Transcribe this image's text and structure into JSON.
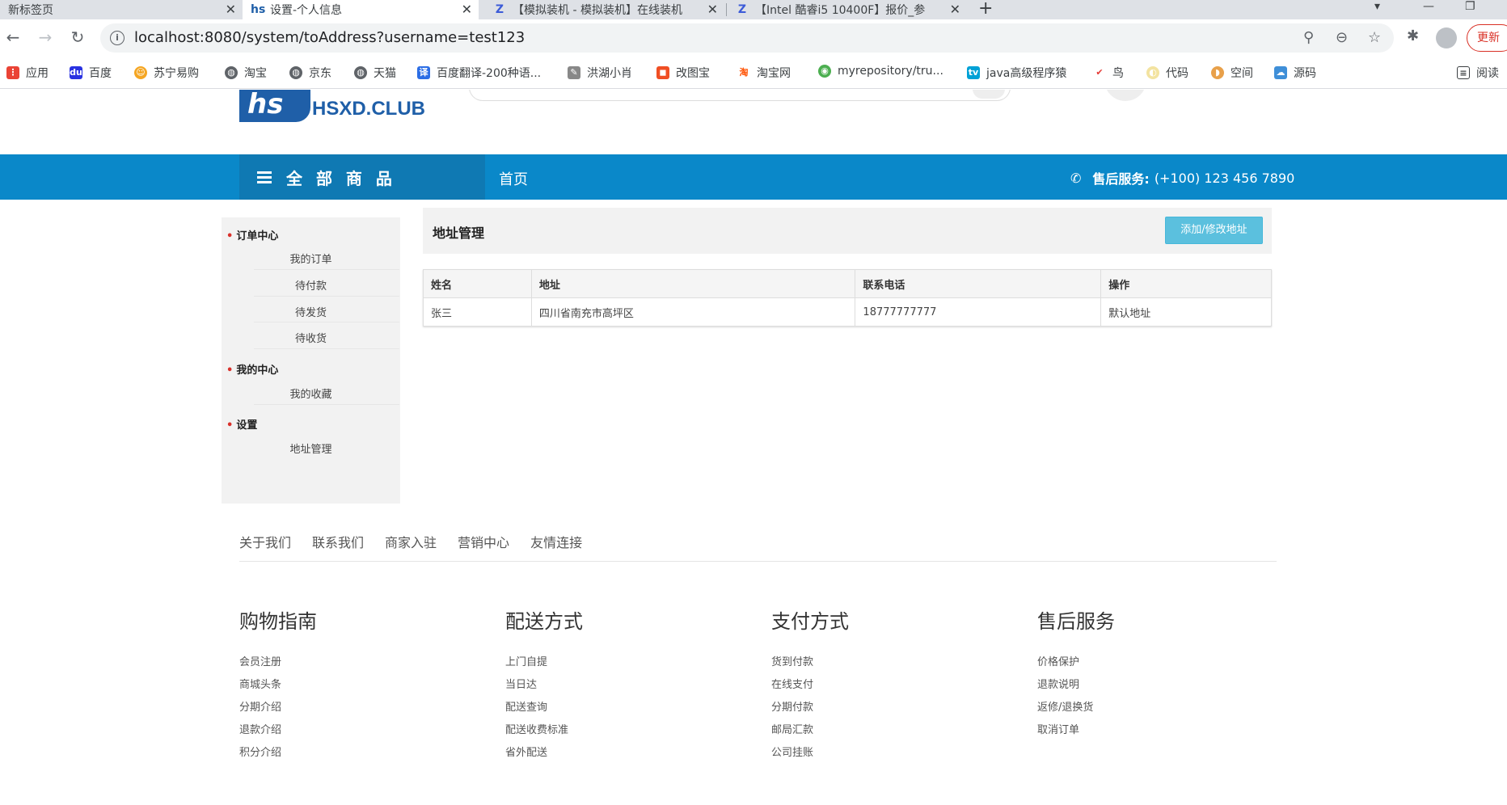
{
  "browser": {
    "tabs": [
      {
        "title": "新标签页"
      },
      {
        "title": "设置-个人信息"
      },
      {
        "title": "【模拟装机 - 模拟装机】在线装机"
      },
      {
        "title": "【Intel 酷睿i5 10400F】报价_参"
      }
    ],
    "url": "localhost:8080/system/toAddress?username=test123",
    "update_label": "更新",
    "bookmarks": [
      "应用",
      "百度",
      "苏宁易购",
      "淘宝",
      "京东",
      "天猫",
      "百度翻译-200种语...",
      "洪湖小肖",
      "改图宝",
      "淘宝网",
      "myrepository/tru...",
      "java高级程序猿",
      "鸟",
      "代码",
      "空间",
      "源码",
      "阅读"
    ]
  },
  "site": {
    "logo_text": "HSXD.CLUB",
    "nav": {
      "all_categories": "全 部 商 品",
      "home": "首页",
      "service_label": "售后服务:",
      "service_phone": "(+100) 123 456 7890"
    }
  },
  "sidebar": {
    "sections": [
      {
        "title": "订单中心",
        "items": [
          "我的订单",
          "待付款",
          "待发货",
          "待收货"
        ]
      },
      {
        "title": "我的中心",
        "items": [
          "我的收藏"
        ]
      },
      {
        "title": "设置",
        "items": [
          "地址管理"
        ]
      }
    ]
  },
  "address": {
    "title": "地址管理",
    "button": "添加/修改地址",
    "columns": [
      "姓名",
      "地址",
      "联系电话",
      "操作"
    ],
    "rows": [
      [
        "张三",
        "四川省南充市高坪区",
        "18777777777",
        "默认地址"
      ]
    ]
  },
  "footer": {
    "links": [
      "关于我们",
      "联系我们",
      "商家入驻",
      "营销中心",
      "友情连接"
    ],
    "columns": [
      {
        "title": "购物指南",
        "items": [
          "会员注册",
          "商城头条",
          "分期介绍",
          "退款介绍",
          "积分介绍"
        ]
      },
      {
        "title": "配送方式",
        "items": [
          "上门自提",
          "当日达",
          "配送查询",
          "配送收费标准",
          "省外配送"
        ]
      },
      {
        "title": "支付方式",
        "items": [
          "货到付款",
          "在线支付",
          "分期付款",
          "邮局汇款",
          "公司挂账"
        ]
      },
      {
        "title": "售后服务",
        "items": [
          "价格保护",
          "退款说明",
          "返修/退换货",
          "取消订单"
        ]
      }
    ]
  },
  "colors": {
    "nav_blue": "#0a88c9",
    "nav_dark": "#0f79b3",
    "button": "#5bc0de",
    "bullet": "#d9312b"
  }
}
